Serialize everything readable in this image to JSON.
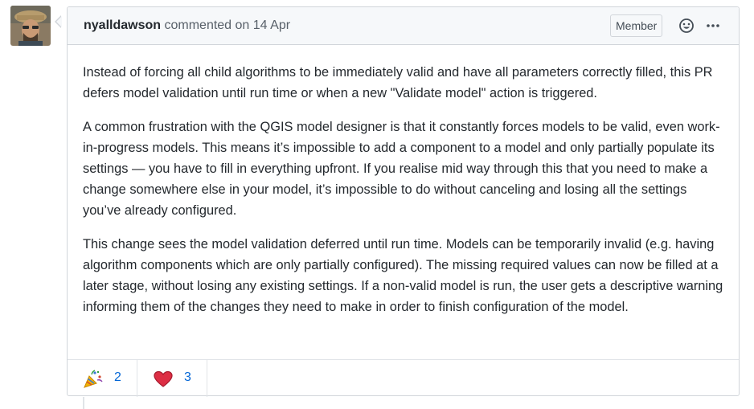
{
  "comment": {
    "author": "nyalldawson",
    "action": "commented on",
    "date": "14 Apr",
    "badge": "Member",
    "paragraphs": [
      "Instead of forcing all child algorithms to be immediately valid and have all parameters correctly filled, this PR defers model validation until run time or when a new \"Validate model\" action is triggered.",
      "A common frustration with the QGIS model designer is that it constantly forces models to be valid, even work-in-progress models. This means it’s impossible to add a component to a model and only partially populate its settings — you have to fill in everything upfront. If you realise mid way through this that you need to make a change somewhere else in your model, it’s impossible to do without canceling and losing all the settings you’ve already configured.",
      "This change sees the model validation deferred until run time. Models can be temporarily invalid (e.g. having algorithm components which are only partially configured). The missing required values can now be filled at a later stage, without losing any existing settings. If a non-valid model is run, the user gets a descriptive warning informing them of the changes they need to make in order to finish configuration of the model."
    ]
  },
  "reactions": [
    {
      "icon": "tada-icon",
      "count": "2"
    },
    {
      "icon": "heart-icon",
      "count": "3"
    }
  ],
  "colors": {
    "link": "#0366d6",
    "header_bg": "#f6f8fa",
    "border": "#d1d5da",
    "heart": "#e0245e"
  }
}
